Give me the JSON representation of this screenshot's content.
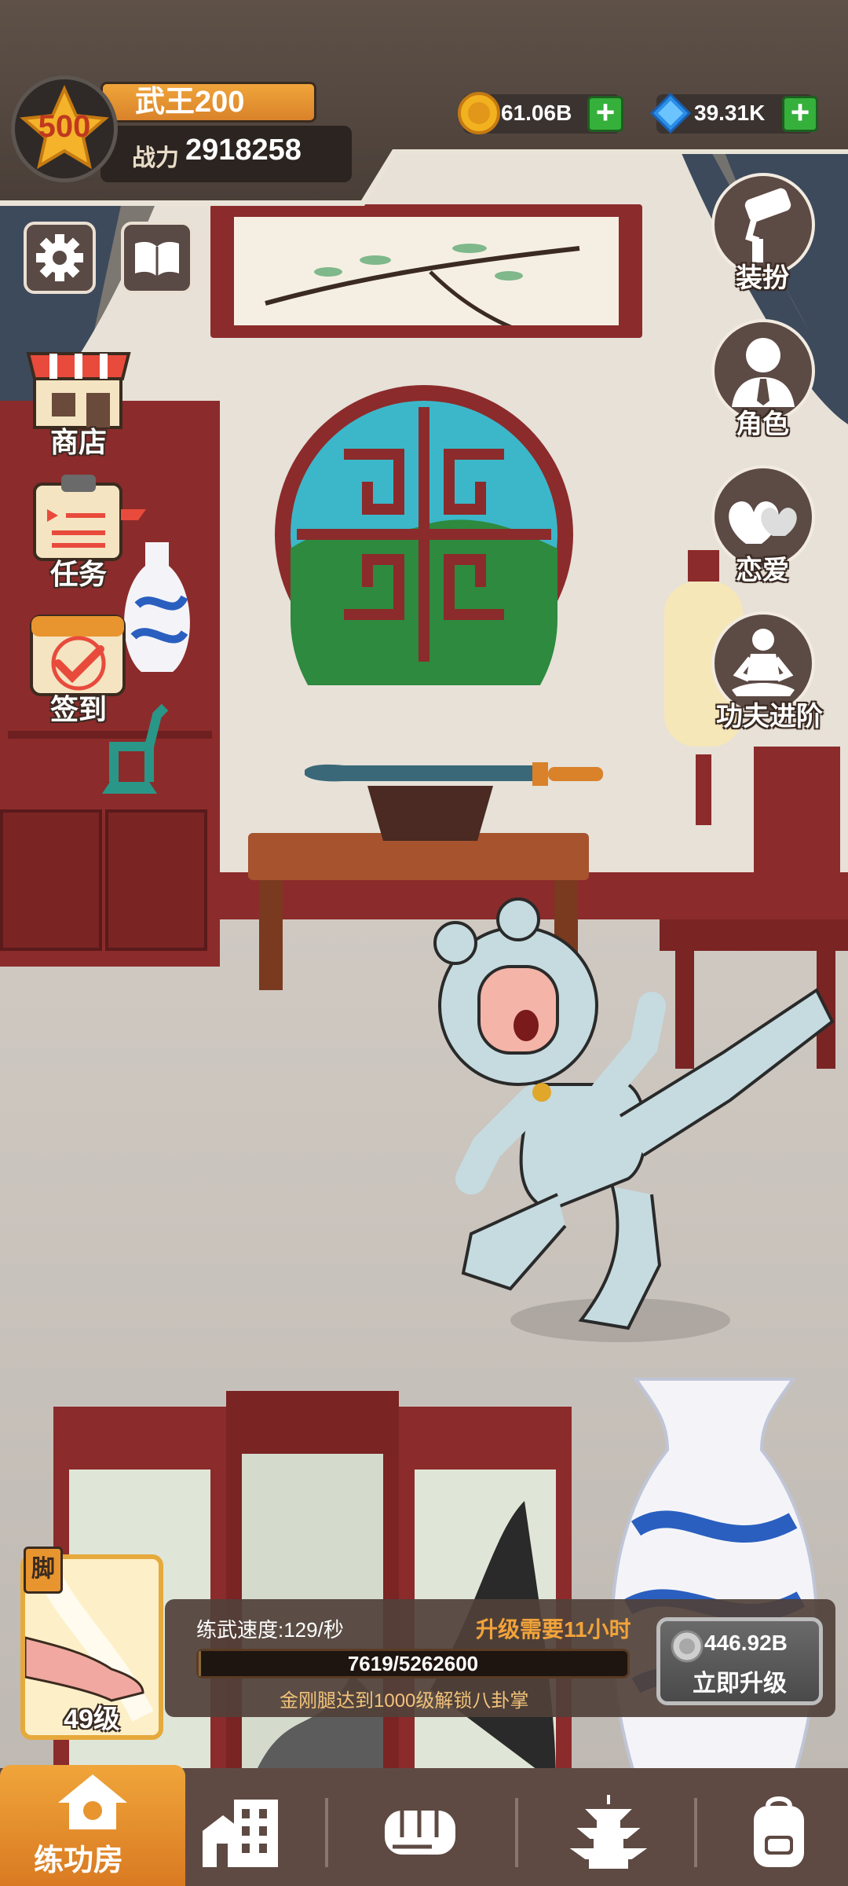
{
  "player": {
    "level_badge": "500",
    "name": "武王200",
    "power_label": "战力",
    "power_value": "2918258"
  },
  "currencies": {
    "gold": "61.06B",
    "gems": "39.31K"
  },
  "right_menu": {
    "dress_up": "装扮",
    "character": "角色",
    "romance": "恋爱",
    "kungfu_advance": "功夫进阶"
  },
  "left_menu": {
    "shop": "商店",
    "tasks": "任务",
    "sign_in": "签到"
  },
  "skill": {
    "tag": "脚",
    "level": "49级",
    "speed_text": "练武速度:129/秒",
    "upgrade_time_text": "升级需要11小时",
    "progress_text": "7619/5262600",
    "progress_fraction": 0.00145,
    "unlock_text": "金刚腿达到1000级解锁八卦掌",
    "upgrade_cost": "446.92B",
    "upgrade_now": "立即升级"
  },
  "nav": {
    "active_label": "练功房",
    "active_index": 0
  },
  "colors": {
    "accent_orange": "#e8952f",
    "header_dark": "#4a3f38",
    "green_plus": "#35b03b",
    "gem_blue": "#2a8ee8"
  },
  "icons": [
    "gear-icon",
    "book-icon",
    "roller-icon",
    "person-icon",
    "hearts-icon",
    "meditation-icon",
    "house-icon",
    "buildings-icon",
    "fist-icon",
    "pagoda-icon",
    "backpack-icon",
    "gold-coin-icon",
    "gem-icon",
    "plus-icon",
    "silver-coin-icon"
  ]
}
